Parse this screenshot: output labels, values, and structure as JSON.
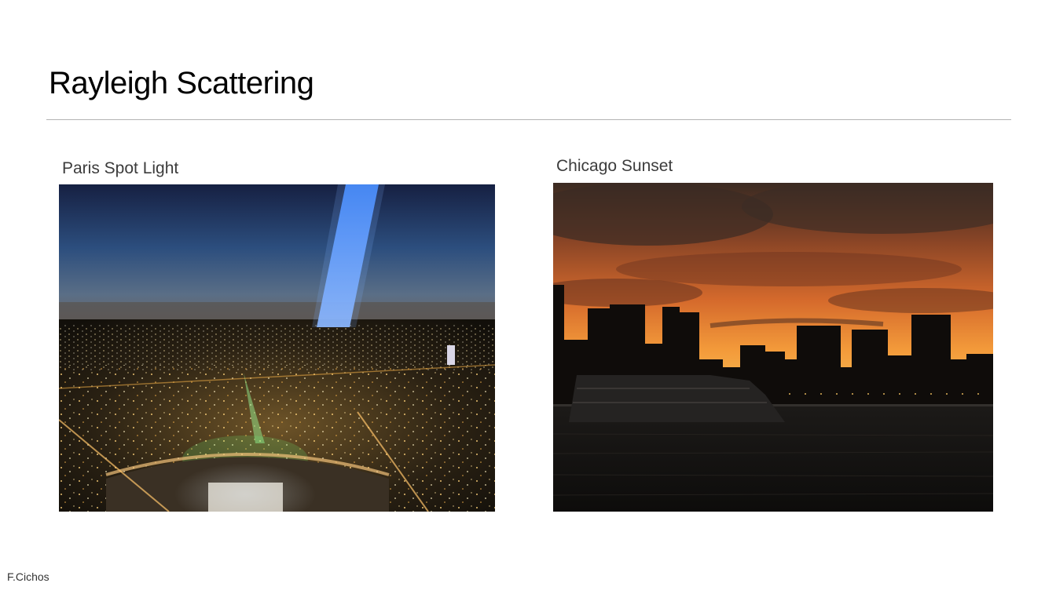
{
  "slide": {
    "title": "Rayleigh Scattering",
    "footer": "F.Cichos"
  },
  "figures": [
    {
      "caption": "Paris Spot Light"
    },
    {
      "caption": "Chicago Sunset"
    }
  ],
  "colors": {
    "background": "#ffffff",
    "title_text": "#000000",
    "caption_text": "#3c3c3c",
    "divider": "#b4b4b4"
  }
}
